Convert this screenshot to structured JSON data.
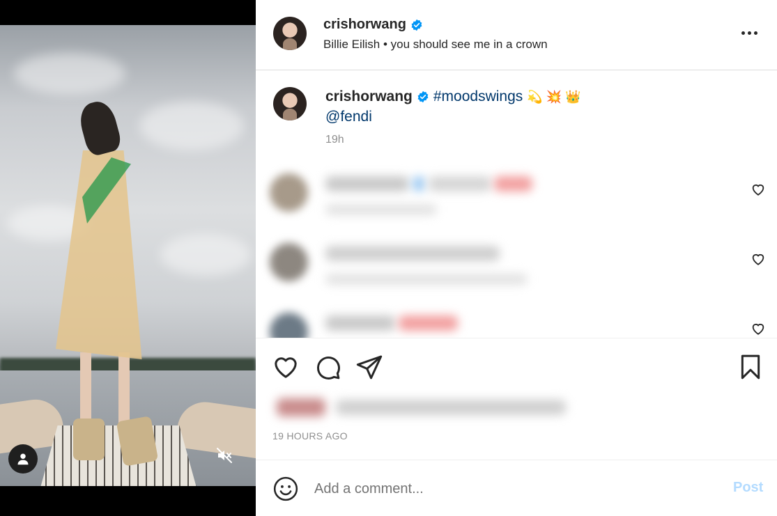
{
  "post": {
    "username": "crishorwang",
    "audio": "Billie Eilish • you should see me in a crown",
    "verified": true
  },
  "caption": {
    "username": "crishorwang",
    "hashtag": "#moodswings",
    "emojis": "💫 💥 👑",
    "mention": "@fendi",
    "time": "19h"
  },
  "footer": {
    "timestamp": "19 HOURS AGO"
  },
  "comment_box": {
    "placeholder": "Add a comment...",
    "post_label": "Post"
  },
  "colors": {
    "link": "#00376b",
    "verified": "#0095f6",
    "post_disabled": "#b3dbff",
    "muted_text": "#8e8e8e"
  }
}
